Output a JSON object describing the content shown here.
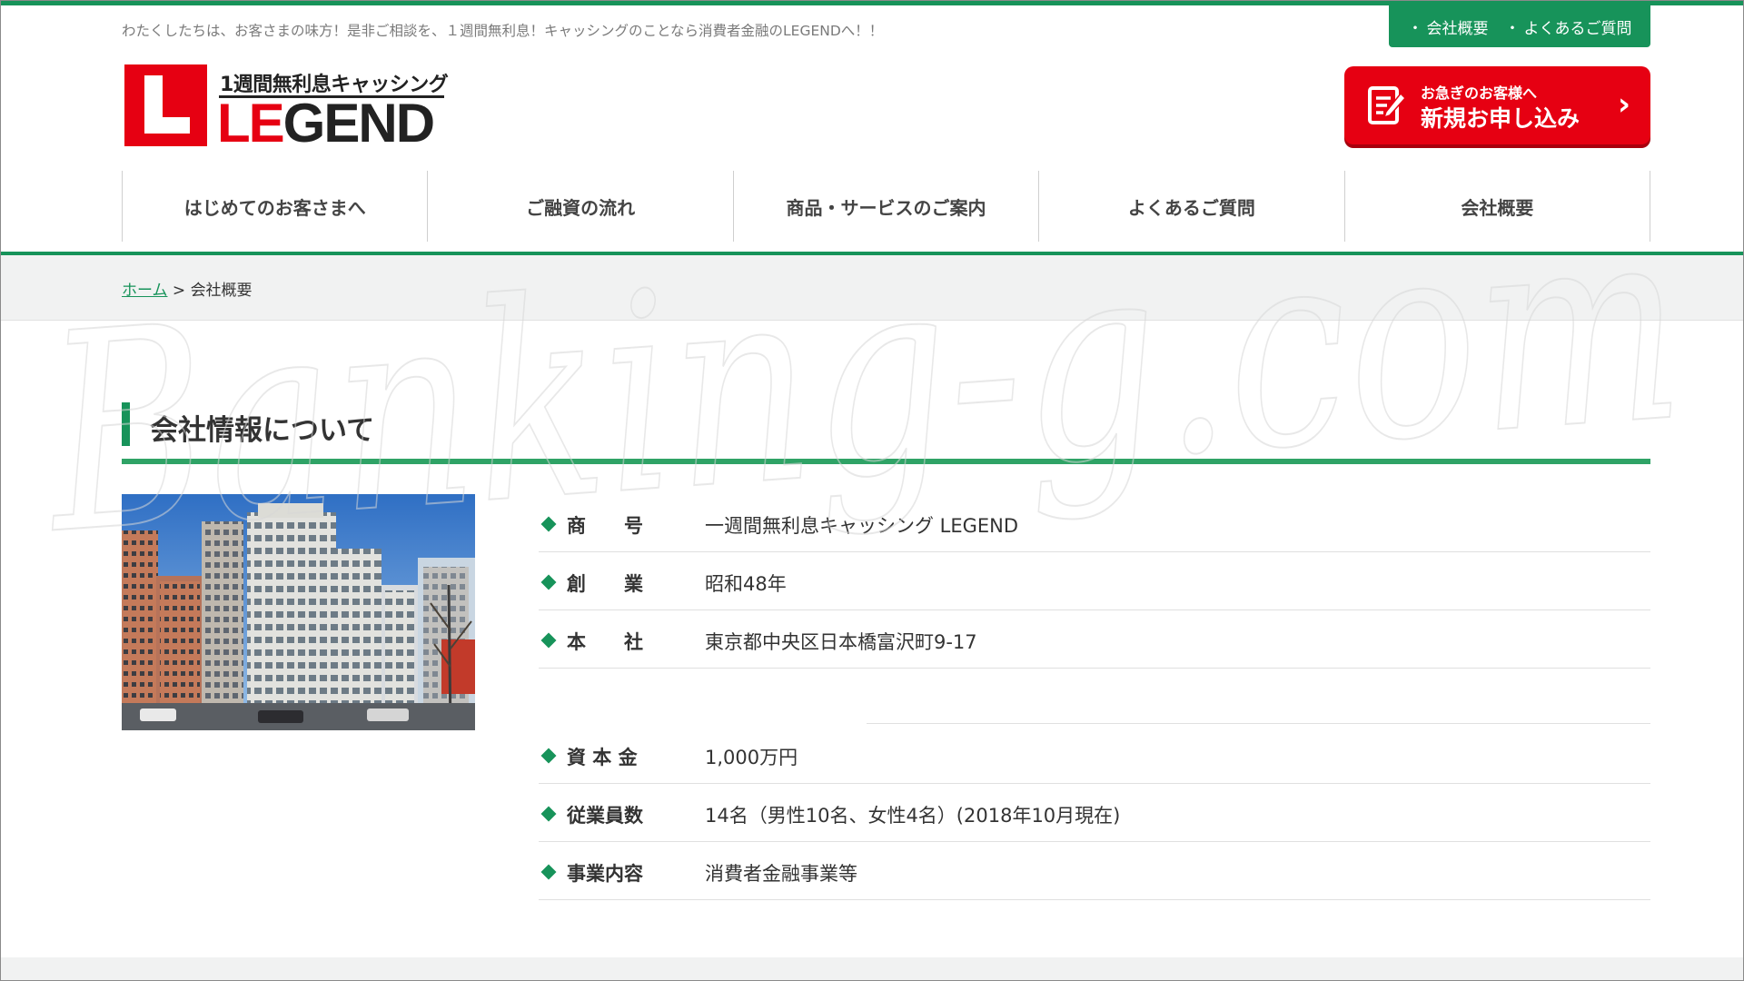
{
  "header": {
    "tagline": "わたくしたちは、お客さまの味方！是非ご相談を、１週間無利息！キャッシングのことなら消費者金融のLEGENDへ！！",
    "top_links": [
      {
        "label": "会社概要"
      },
      {
        "label": "よくあるご質問"
      }
    ],
    "logo": {
      "subtitle": "1週間無利息キャッシング",
      "name_red": "LE",
      "name_black": "GEND"
    },
    "apply_button": {
      "sub_label": "お急ぎのお客様へ",
      "main_label": "新規お申し込み"
    }
  },
  "nav": {
    "items": [
      {
        "label": "はじめてのお客さまへ"
      },
      {
        "label": "ご融資の流れ"
      },
      {
        "label": "商品・サービスのご案内"
      },
      {
        "label": "よくあるご質問"
      },
      {
        "label": "会社概要"
      }
    ]
  },
  "breadcrumb": {
    "home": "ホーム",
    "separator": " > ",
    "current": "会社概要"
  },
  "main": {
    "title": "会社情報について",
    "rows": [
      {
        "label": "商　　号",
        "value": "一週間無利息キャッシング LEGEND"
      },
      {
        "label": "創　　業",
        "value": "昭和48年"
      },
      {
        "label": "本　　社",
        "value": "東京都中央区日本橋富沢町9-17"
      },
      {
        "label": "資 本 金",
        "value": "1,000万円"
      },
      {
        "label": "従業員数",
        "value": "14名（男性10名、女性4名）(2018年10月現在)"
      },
      {
        "label": "事業内容",
        "value": "消費者金融事業等"
      }
    ]
  },
  "watermark": "Banking-g.com",
  "colors": {
    "brand_green": "#17935a",
    "brand_red": "#e60012"
  }
}
